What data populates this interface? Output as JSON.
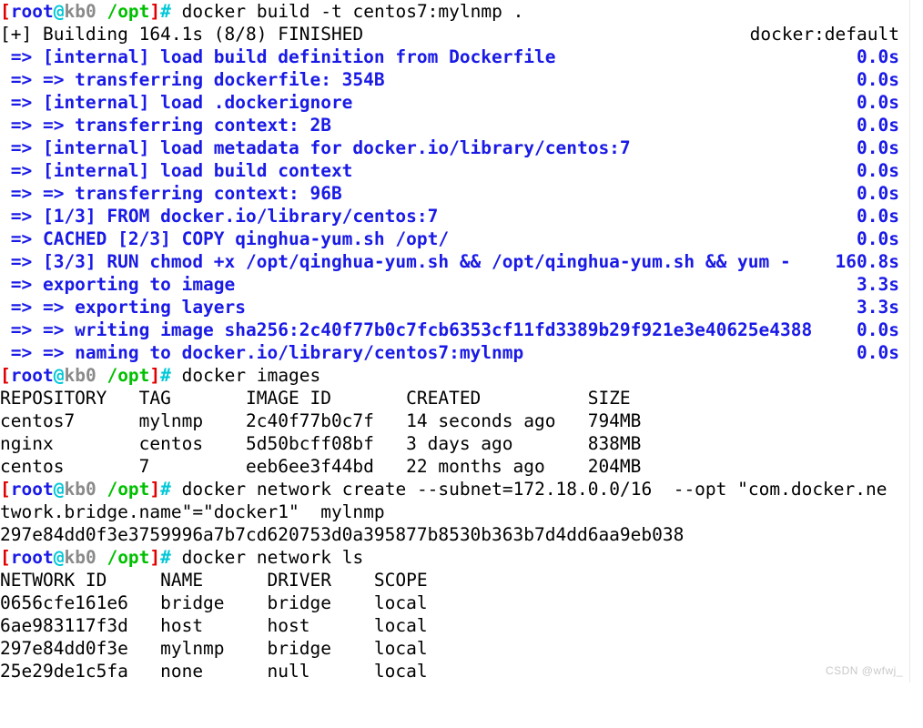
{
  "terminal": {
    "background": "#ffffff",
    "foreground": "#000000",
    "build_color": "#1a1ae6",
    "prompt": {
      "open_bracket": "[",
      "user": "root",
      "at": "@",
      "host": "kb0",
      "path": "/opt",
      "close_bracket": "]",
      "sigil": "#",
      "colors": {
        "bracket": "#e00000",
        "user": "#1a1ae6",
        "at": "#00c8d7",
        "host": "#8a8a8a",
        "path": "#00c000",
        "sigil": "#00c8d7"
      }
    },
    "commands": {
      "build": " docker build -t centos7:mylnmp .",
      "images": " docker images",
      "network_create": " docker network create --subnet=172.18.0.0/16  --opt \"com.docker.ne",
      "network_create_wrap": "twork.bridge.name\"=\"docker1\"  mylnmp",
      "network_ls": " docker network ls"
    },
    "build_summary": {
      "text": "[+] Building 164.1s (8/8) FINISHED",
      "right": "docker:default"
    },
    "build_steps": [
      {
        "text": " => [internal] load build definition from Dockerfile",
        "time": "0.0s"
      },
      {
        "text": " => => transferring dockerfile: 354B",
        "time": "0.0s"
      },
      {
        "text": " => [internal] load .dockerignore",
        "time": "0.0s"
      },
      {
        "text": " => => transferring context: 2B",
        "time": "0.0s"
      },
      {
        "text": " => [internal] load metadata for docker.io/library/centos:7",
        "time": "0.0s"
      },
      {
        "text": " => [internal] load build context",
        "time": "0.0s"
      },
      {
        "text": " => => transferring context: 96B",
        "time": "0.0s"
      },
      {
        "text": " => [1/3] FROM docker.io/library/centos:7",
        "time": "0.0s"
      },
      {
        "text": " => CACHED [2/3] COPY qinghua-yum.sh /opt/",
        "time": "0.0s"
      },
      {
        "text": " => [3/3] RUN chmod +x /opt/qinghua-yum.sh && /opt/qinghua-yum.sh && yum -",
        "time": "160.8s"
      },
      {
        "text": " => exporting to image",
        "time": "3.3s"
      },
      {
        "text": " => => exporting layers",
        "time": "3.3s"
      },
      {
        "text": " => => writing image sha256:2c40f77b0c7fcb6353cf11fd3389b29f921e3e40625e4388",
        "time": "0.0s"
      },
      {
        "text": " => => naming to docker.io/library/centos7:mylnmp",
        "time": "0.0s"
      }
    ],
    "images_table": {
      "header": "REPOSITORY   TAG       IMAGE ID       CREATED          SIZE",
      "rows": [
        "centos7      mylnmp    2c40f77b0c7f   14 seconds ago   794MB",
        "nginx        centos    5d50bcff08bf   3 days ago       838MB",
        "centos       7         eeb6ee3f44bd   22 months ago    204MB"
      ]
    },
    "network_id_output": "297e84dd0f3e3759996a7b7cd620753d0a395877b8530b363b7d4dd6aa9eb038",
    "network_table": {
      "header": "NETWORK ID     NAME      DRIVER    SCOPE",
      "rows": [
        "0656cfe161e6   bridge    bridge    local",
        "6ae983117f3d   host      host      local",
        "297e84dd0f3e   mylnmp    bridge    local",
        "25e29de1c5fa   none      null      local"
      ]
    },
    "watermark": "CSDN @wfwj_"
  }
}
